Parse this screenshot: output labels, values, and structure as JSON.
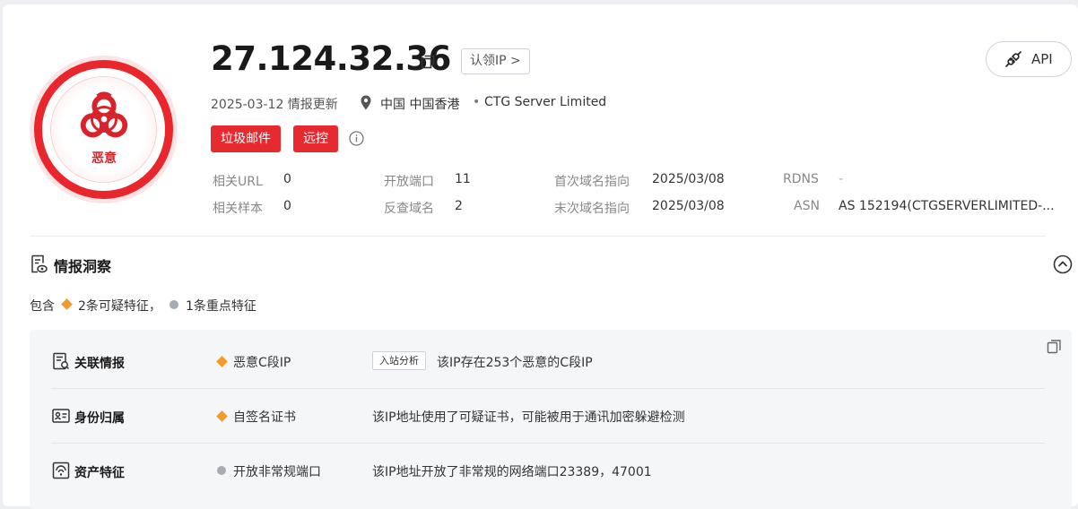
{
  "badge": {
    "label": "恶意",
    "icon": "biohazard-icon",
    "color": "#e8262c"
  },
  "header": {
    "ip": "27.124.32.36",
    "claim_button": "认领IP >",
    "api_button": "API",
    "date": "2025-03-12 情报更新",
    "location": "中国 中国香港",
    "org_separator": "•",
    "org": "CTG Server Limited",
    "tags": [
      "垃圾邮件",
      "远控"
    ]
  },
  "stats": {
    "related_url": {
      "label": "相关URL",
      "value": "0"
    },
    "related_sample": {
      "label": "相关样本",
      "value": "0"
    },
    "open_ports": {
      "label": "开放端口",
      "value": "11"
    },
    "reverse_domains": {
      "label": "反查域名",
      "value": "2"
    },
    "first_domain": {
      "label": "首次域名指向",
      "value": "2025/03/08"
    },
    "last_domain": {
      "label": "末次域名指向",
      "value": "2025/03/08"
    },
    "rdns": {
      "label": "RDNS",
      "value": "-"
    },
    "asn": {
      "label": "ASN",
      "value": "AS 152194(CTGSERVERLIMITED-..."
    }
  },
  "section": {
    "title": "情报洞察",
    "summary_prefix": "包含",
    "summary_suspicious": "2条可疑特征，",
    "summary_key": "1条重点特征"
  },
  "rows": [
    {
      "title": "关联情报",
      "feature": "恶意C段IP",
      "chip": "入站分析",
      "desc": "该IP存在253个恶意的C段IP",
      "level": "suspicious"
    },
    {
      "title": "身份归属",
      "feature": "自签名证书",
      "desc": "该IP地址使用了可疑证书，可能被用于通讯加密躲避检测",
      "level": "suspicious"
    },
    {
      "title": "资产特征",
      "feature": "开放非常规端口",
      "desc": "该IP地址开放了非常规的网络端口23389，47001",
      "level": "key"
    }
  ],
  "colors": {
    "danger": "#e62a30",
    "suspicious": "#f29b2a",
    "key": "#a7acb3"
  }
}
